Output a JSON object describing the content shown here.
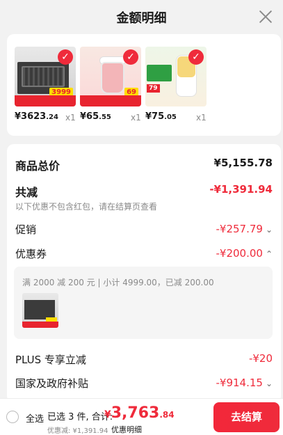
{
  "header": {
    "title": "金额明细",
    "close_icon": "close-icon"
  },
  "products": [
    {
      "name": "dishwasher",
      "price_main": "¥3623",
      "price_decimal": ".24",
      "qty": "x1",
      "badge": "3999"
    },
    {
      "name": "food-processor",
      "price_main": "¥65",
      "price_decimal": ".55",
      "qty": "x1",
      "badge": "69"
    },
    {
      "name": "juicer",
      "price_main": "¥75",
      "price_decimal": ".05",
      "qty": "x1",
      "badge": "79"
    }
  ],
  "summary": {
    "total_label": "商品总价",
    "total_value": "¥5,155.78",
    "reduce_label": "共减",
    "reduce_value": "-¥1,391.94",
    "reduce_note": "以下优惠不包含红包，请在结算页查看",
    "promo_label": "促销",
    "promo_value": "-¥257.79",
    "coupon_label": "优惠券",
    "coupon_value": "-¥200.00",
    "coupon_detail": "满 2000 减 200 元 | 小计 4999.00，已减 200.00",
    "plus_label": "PLUS 专享立减",
    "plus_value": "-¥20",
    "gov_label": "国家及政府补贴",
    "gov_value": "-¥914.15"
  },
  "bottom": {
    "select_all": "全选",
    "selected_text": "已选 3 件, 合计:",
    "currency": "¥",
    "total_int": "3,763",
    "total_dec": ".84",
    "discount_text": "优惠减: ¥1,391.94",
    "detail_link": "优惠明细",
    "checkout": "去结算"
  },
  "colors": {
    "accent": "#ef2b3b",
    "background": "#f2f2f2"
  }
}
